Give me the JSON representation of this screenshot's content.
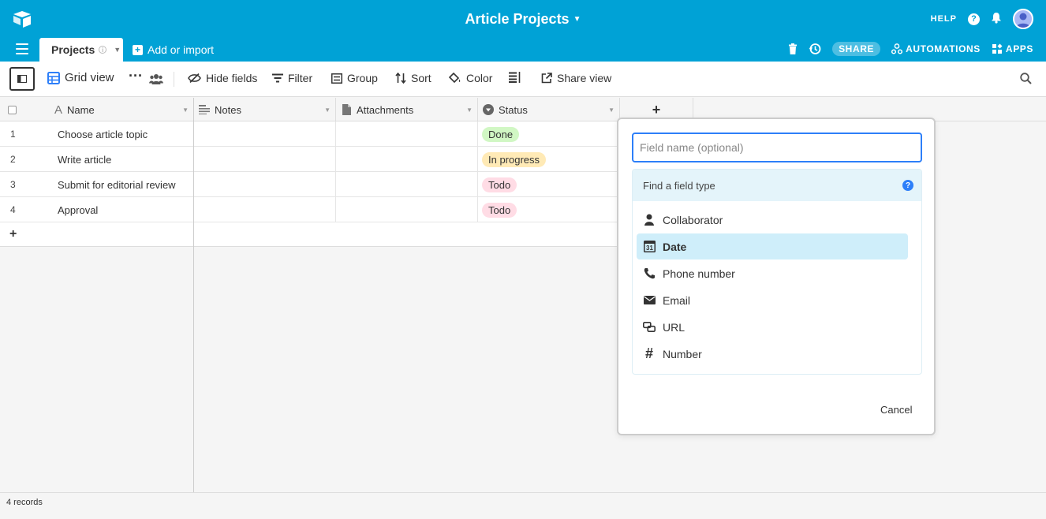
{
  "header": {
    "base_title": "Article Projects",
    "help_label": "HELP"
  },
  "tabs": {
    "active": "Projects",
    "add_import": "Add or import",
    "share_label": "SHARE",
    "automations_label": "AUTOMATIONS",
    "apps_label": "APPS"
  },
  "viewbar": {
    "view_name": "Grid view",
    "hide_fields": "Hide fields",
    "filter": "Filter",
    "group": "Group",
    "sort": "Sort",
    "color": "Color",
    "share_view": "Share view"
  },
  "columns": [
    "Name",
    "Notes",
    "Attachments",
    "Status"
  ],
  "rows": [
    {
      "num": "1",
      "name": "Choose article topic",
      "status": "Done",
      "status_bg": "#d1f7c4"
    },
    {
      "num": "2",
      "name": "Write article",
      "status": "In progress",
      "status_bg": "#ffeab6"
    },
    {
      "num": "3",
      "name": "Submit for editorial review",
      "status": "Todo",
      "status_bg": "#ffdce5"
    },
    {
      "num": "4",
      "name": "Approval",
      "status": "Todo",
      "status_bg": "#ffdce5"
    }
  ],
  "footer": {
    "record_count": "4 records"
  },
  "popup": {
    "field_name_placeholder": "Field name (optional)",
    "search_placeholder": "Find a field type",
    "field_types": [
      "Collaborator",
      "Date",
      "Phone number",
      "Email",
      "URL",
      "Number"
    ],
    "field_type_icons": [
      "person-icon",
      "calendar-icon",
      "phone-icon",
      "envelope-icon",
      "link-icon",
      "hash-icon"
    ],
    "selected_type": "Date",
    "cancel_label": "Cancel"
  },
  "colors": {
    "header_bg": "#00a2d6",
    "accent_blue": "#2d7ff9",
    "selected_bg": "#cfeefa"
  }
}
